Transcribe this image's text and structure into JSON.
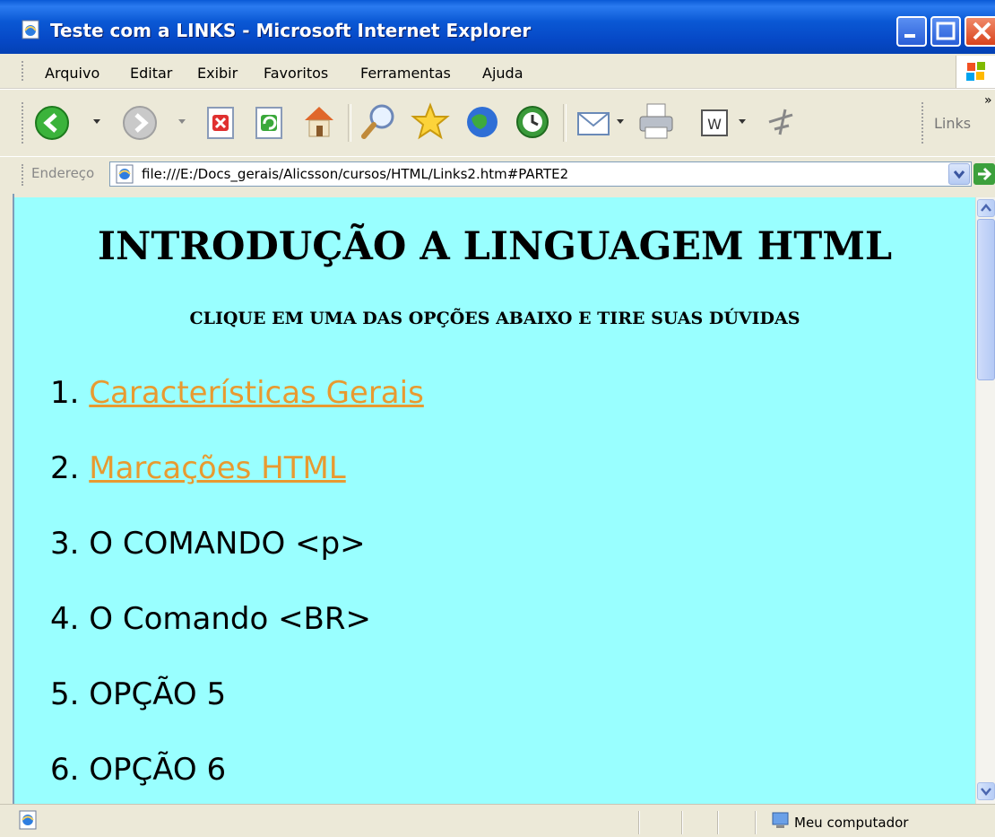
{
  "window": {
    "title": "Teste com a LINKS - Microsoft Internet Explorer"
  },
  "menu": [
    "Arquivo",
    "Editar",
    "Exibir",
    "Favoritos",
    "Ferramentas",
    "Ajuda"
  ],
  "toolbar": {
    "links_label": "Links",
    "chevron": "»",
    "icons": [
      "back-icon",
      "forward-icon",
      "stop-icon",
      "refresh-icon",
      "home-icon",
      "search-icon",
      "favorites-icon",
      "media-icon",
      "history-icon",
      "mail-icon",
      "print-icon",
      "word-edit-icon",
      "messenger-icon"
    ]
  },
  "address": {
    "label": "Endereço",
    "url": "file:///E:/Docs_gerais/Alicsson/cursos/HTML/Links2.htm#PARTE2",
    "go_label": "Ir"
  },
  "page": {
    "heading": "INTRODUÇÃO A LINGUAGEM HTML",
    "subheading": "CLIQUE EM UMA DAS OPÇÕES ABAIXO E TIRE SUAS DÚVIDAS",
    "options": [
      {
        "number": "1.",
        "text": "Características Gerais",
        "link": true
      },
      {
        "number": "2.",
        "text": "Marcações HTML",
        "link": true
      },
      {
        "number": "3.",
        "text": "O COMANDO <p>",
        "link": false
      },
      {
        "number": "4.",
        "text": "O Comando <BR>",
        "link": false
      },
      {
        "number": "5.",
        "text": "OPÇÃO 5",
        "link": false
      },
      {
        "number": "6.",
        "text": "OPÇÃO 6",
        "link": false
      }
    ],
    "background_color": "#99ffff",
    "link_color": "#e89a30"
  },
  "status": {
    "zone": "Meu computador"
  }
}
